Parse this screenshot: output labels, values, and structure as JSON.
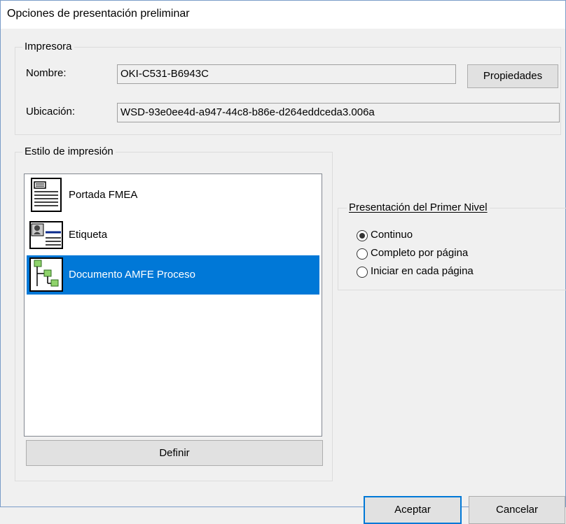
{
  "window": {
    "title": "Opciones de presentación preliminar"
  },
  "printer": {
    "legend": "Impresora",
    "name_label": "Nombre:",
    "name_value": "OKI-C531-B6943C",
    "properties_button": "Propiedades",
    "location_label": "Ubicación:",
    "location_value": "WSD-93e0ee4d-a947-44c8-b86e-d264eddceda3.006a"
  },
  "style": {
    "legend": "Estilo de impresión",
    "items": [
      {
        "label": "Portada FMEA",
        "icon": "document-icon",
        "selected": false
      },
      {
        "label": "Etiqueta",
        "icon": "label-icon",
        "selected": false
      },
      {
        "label": "Documento AMFE Proceso",
        "icon": "tree-document-icon",
        "selected": true
      }
    ],
    "define_button": "Definir"
  },
  "first_level": {
    "legend": "Presentación del Primer Nivel",
    "options": [
      {
        "label": "Continuo",
        "checked": true
      },
      {
        "label": "Completo por página",
        "checked": false
      },
      {
        "label": "Iniciar en cada página",
        "checked": false
      }
    ]
  },
  "buttons": {
    "ok": "Aceptar",
    "cancel": "Cancelar"
  },
  "colors": {
    "selection": "#0078d7",
    "dialog_bg": "#f0f0f0"
  }
}
